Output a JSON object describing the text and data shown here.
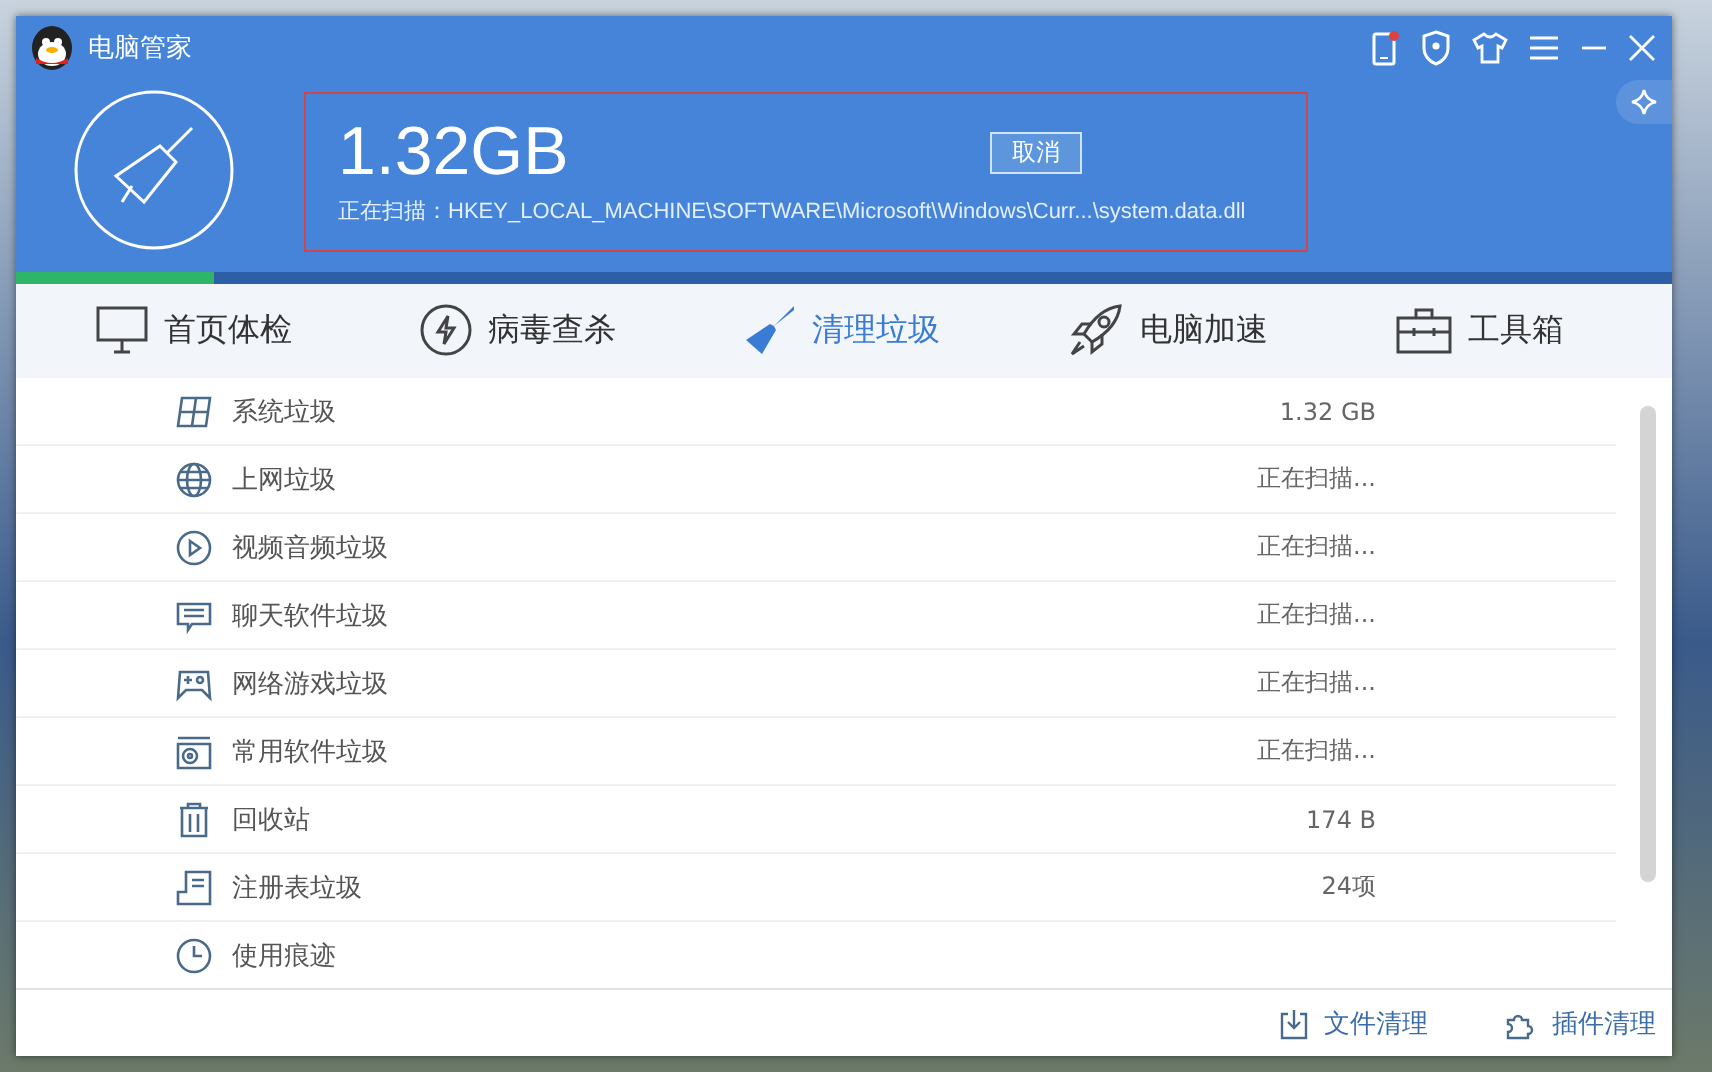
{
  "window": {
    "title": "电脑管家"
  },
  "scan": {
    "size": "1.32GB",
    "cancel": "取消",
    "status": "正在扫描：HKEY_LOCAL_MACHINE\\SOFTWARE\\Microsoft\\Windows\\Curr...\\system.data.dll",
    "level": 0.12
  },
  "tabs": [
    {
      "label": "首页体检",
      "kind": "monitor",
      "selected": false
    },
    {
      "label": "病毒查杀",
      "kind": "bolt",
      "selected": false
    },
    {
      "label": "清理垃圾",
      "kind": "broom",
      "selected": true
    },
    {
      "label": "电脑加速",
      "kind": "rocket",
      "selected": false
    },
    {
      "label": "工具箱",
      "kind": "toolbox",
      "selected": false
    }
  ],
  "items": [
    {
      "name": "系统垃圾",
      "kind": "windows",
      "value": "1.32 GB"
    },
    {
      "name": "上网垃圾",
      "kind": "globe",
      "value": "正在扫描..."
    },
    {
      "name": "视频音频垃圾",
      "kind": "play",
      "value": "正在扫描..."
    },
    {
      "name": "聊天软件垃圾",
      "kind": "chat",
      "value": "正在扫描..."
    },
    {
      "name": "网络游戏垃圾",
      "kind": "gamepad",
      "value": "正在扫描..."
    },
    {
      "name": "常用软件垃圾",
      "kind": "disc",
      "value": "正在扫描..."
    },
    {
      "name": "回收站",
      "kind": "trash",
      "value": "174 B"
    },
    {
      "name": "注册表垃圾",
      "kind": "registry",
      "value": "24项"
    },
    {
      "name": "使用痕迹",
      "kind": "clock"
    }
  ],
  "footer": [
    {
      "label": "文件清理",
      "kind": "file"
    },
    {
      "label": "插件清理",
      "kind": "plugin"
    }
  ]
}
